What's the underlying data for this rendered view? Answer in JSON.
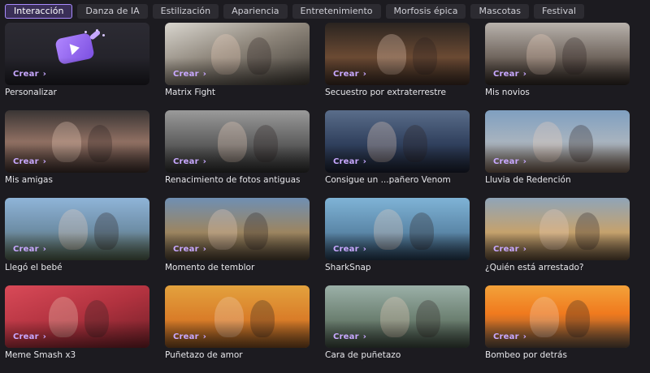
{
  "tabs": [
    {
      "label": "Interacción",
      "active": true
    },
    {
      "label": "Danza de IA",
      "active": false
    },
    {
      "label": "Estilización",
      "active": false
    },
    {
      "label": "Apariencia",
      "active": false
    },
    {
      "label": "Entretenimiento",
      "active": false
    },
    {
      "label": "Morfosis épica",
      "active": false
    },
    {
      "label": "Mascotas",
      "active": false
    },
    {
      "label": "Festival",
      "active": false
    }
  ],
  "cta_label": "Crear",
  "cta_arrow_icon": "chevron-right-icon",
  "accent_color": "#c8a8ff",
  "cards": [
    {
      "title": "Personalizar",
      "bg": "linear-gradient(180deg,#2c2b33,#1f1e25)"
    },
    {
      "title": "Matrix Fight",
      "bg": "linear-gradient(160deg,#d9d6cf,#8f877c 45%,#3c3731)"
    },
    {
      "title": "Secuestro por extraterrestre",
      "bg": "linear-gradient(180deg,#2a2420,#6b4a33 55%,#3a2a22)"
    },
    {
      "title": "Mis novios",
      "bg": "linear-gradient(180deg,#b9b3ad,#6a5f57 60%,#2d2622)"
    },
    {
      "title": "Mis amigas",
      "bg": "linear-gradient(180deg,#3a3534,#8f6f62 50%,#3a2c29)"
    },
    {
      "title": "Renacimiento de fotos antiguas",
      "bg": "linear-gradient(180deg,#9a9a9a,#5d5d5d 55%,#2c2c2c)"
    },
    {
      "title": "Consigue un ...pañero Venom",
      "bg": "linear-gradient(180deg,#5a6d8a,#2f3f5c 55%,#1a1f2d)"
    },
    {
      "title": "Lluvia de Redención",
      "bg": "linear-gradient(180deg,#7f9fc0,#a7b3bf 50%,#6e5a4b)"
    },
    {
      "title": "Llegó el bebé",
      "bg": "linear-gradient(180deg,#8fb4d8,#6f8fa8 50%,#4e5d49)"
    },
    {
      "title": "Momento de temblor",
      "bg": "linear-gradient(180deg,#6f8fb3,#9c8560 55%,#4b3f30)"
    },
    {
      "title": "SharkSnap",
      "bg": "linear-gradient(180deg,#7fb3d6,#5b87a8 55%,#23384d)"
    },
    {
      "title": "¿Quién está arrestado?",
      "bg": "linear-gradient(180deg,#8fa4b8,#c5a26d 55%,#5e4a36)"
    },
    {
      "title": "Meme Smash x3",
      "bg": "linear-gradient(160deg,#d94a58,#b1323f 50%,#6e1f27)"
    },
    {
      "title": "Puñetazo de amor",
      "bg": "linear-gradient(180deg,#e3a23e,#d97c28 55%,#7a4a20)"
    },
    {
      "title": "Cara de puñetazo",
      "bg": "linear-gradient(180deg,#9bb0a8,#6b7f70 55%,#3a463c)"
    },
    {
      "title": "Bombeo por detrás",
      "bg": "linear-gradient(180deg,#f3a23a,#f07a1e 45%,#5c4a3c)"
    }
  ]
}
